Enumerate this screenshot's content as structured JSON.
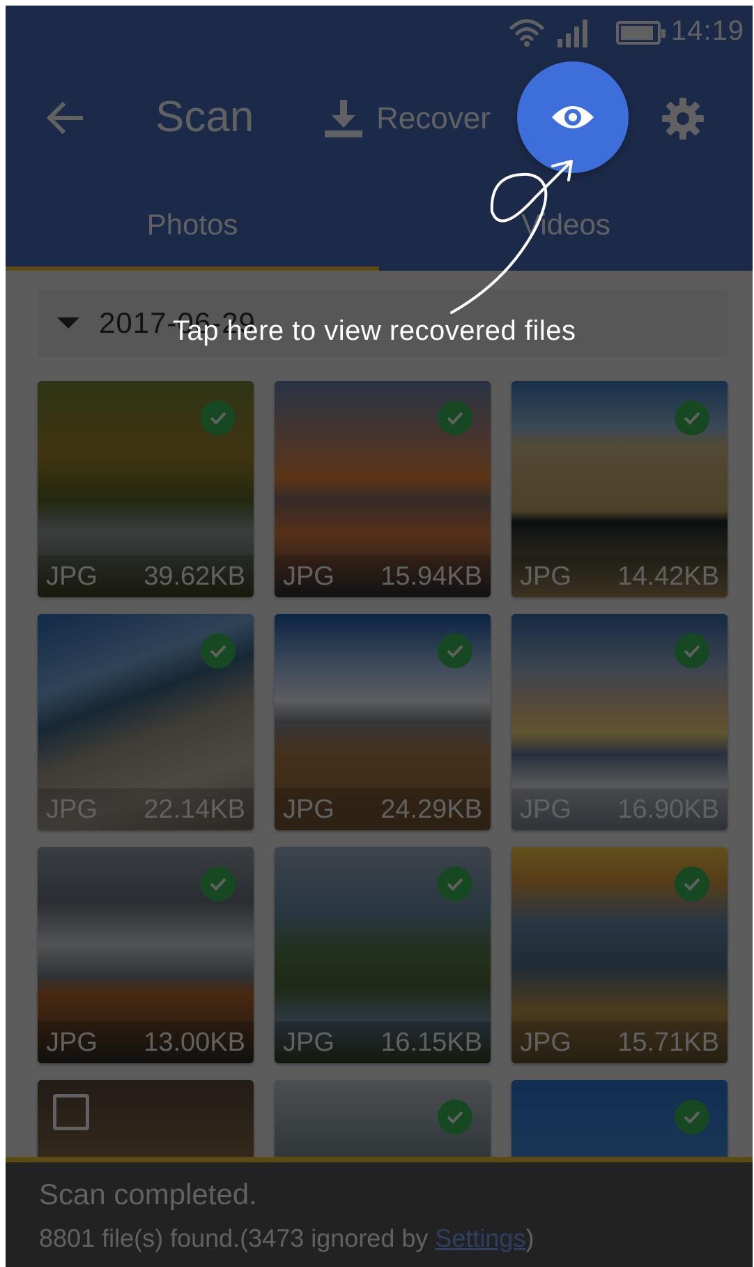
{
  "status_bar": {
    "time": "14:19",
    "wifi_icon": "wifi-icon",
    "signal_icon": "signal-icon",
    "battery_icon": "battery-icon"
  },
  "toolbar": {
    "back_icon": "arrow-left-icon",
    "title": "Scan",
    "recover_label": "Recover",
    "recover_icon": "download-icon",
    "view_button_icon": "eye-icon",
    "settings_icon": "gear-icon",
    "accent_color": "#4a6fc0",
    "view_button_color": "#3d6ed9"
  },
  "tabs": [
    {
      "label": "Photos",
      "selected": true
    },
    {
      "label": "Videos",
      "selected": false
    }
  ],
  "tab_indicator_color": "#f3c63c",
  "date_group": {
    "label": "2017-06-29",
    "caret_icon": "caret-down-icon"
  },
  "coach_mark": {
    "text": "Tap here to view recovered files",
    "arrow_icon": "curved-arrow-icon"
  },
  "files": [
    {
      "type": "JPG",
      "size": "39.62KB",
      "checked": true
    },
    {
      "type": "JPG",
      "size": "15.94KB",
      "checked": true
    },
    {
      "type": "JPG",
      "size": "14.42KB",
      "checked": true
    },
    {
      "type": "JPG",
      "size": "22.14KB",
      "checked": true
    },
    {
      "type": "JPG",
      "size": "24.29KB",
      "checked": true
    },
    {
      "type": "JPG",
      "size": "16.90KB",
      "checked": true
    },
    {
      "type": "JPG",
      "size": "13.00KB",
      "checked": true
    },
    {
      "type": "JPG",
      "size": "16.15KB",
      "checked": true
    },
    {
      "type": "JPG",
      "size": "15.71KB",
      "checked": true
    },
    {
      "checked": false
    },
    {
      "checked": true
    },
    {
      "checked": true
    }
  ],
  "snackbar": {
    "title": "Scan completed.",
    "message_prefix": "8801 file(s) found.(3473 ignored by ",
    "link_label": "Settings",
    "message_suffix": ")"
  }
}
